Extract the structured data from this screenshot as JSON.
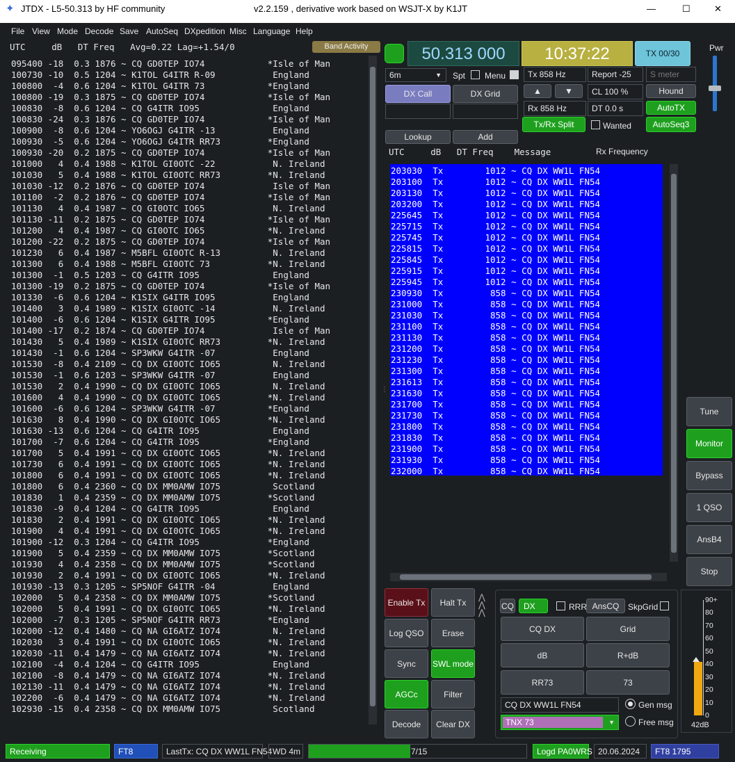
{
  "window": {
    "title": "JTDX - L5-50.313  by HF community",
    "version": "v2.2.159 , derivative work based on WSJT-X by K1JT",
    "minimize": "—",
    "maximize": "☐",
    "close": "✕"
  },
  "menu": [
    "File",
    "View",
    "Mode",
    "Decode",
    "Save",
    "AutoSeq",
    "DXpedition",
    "Misc",
    "Language",
    "Help"
  ],
  "band_header": "UTC     dB   DT Freq   Avg=0.22 Lag=+1.54/0",
  "band_activity_label": "Band Activity",
  "band_rows": [
    "095400 -18  0.3 1876 ~ CQ GD0TEP IO74            *Isle of Man",
    "100730 -10  0.5 1204 ~ K1TOL G4ITR R-09           England",
    "100800  -4  0.6 1204 ~ K1TOL G4ITR 73            *England",
    "100800 -19  0.3 1875 ~ CQ GD0TEP IO74            *Isle of Man",
    "100830  -8  0.6 1204 ~ CQ G4ITR IO95              England",
    "100830 -24  0.3 1876 ~ CQ GD0TEP IO74            *Isle of Man",
    "100900  -8  0.6 1204 ~ YO6OGJ G4ITR -13           England",
    "100930  -5  0.6 1204 ~ YO6OGJ G4ITR RR73         *England",
    "100930 -20  0.2 1875 ~ CQ GD0TEP IO74            *Isle of Man",
    "101000   4  0.4 1988 ~ K1TOL GI0OTC -22           N. Ireland",
    "101030   5  0.4 1988 ~ K1TOL GI0OTC RR73         *N. Ireland",
    "101030 -12  0.2 1876 ~ CQ GD0TEP IO74             Isle of Man",
    "101100  -2  0.2 1876 ~ CQ GD0TEP IO74            *Isle of Man",
    "101130   4  0.4 1987 ~ CQ GI0OTC IO65             N. Ireland",
    "101130 -11  0.2 1875 ~ CQ GD0TEP IO74            *Isle of Man",
    "101200   4  0.4 1987 ~ CQ GI0OTC IO65            *N. Ireland",
    "101200 -22  0.2 1875 ~ CQ GD0TEP IO74            *Isle of Man",
    "101230   6  0.4 1987 ~ M5BFL GI0OTC R-13          N. Ireland",
    "101300   6  0.4 1988 ~ M5BFL GI0OTC 73           *N. Ireland",
    "101300  -1  0.5 1203 ~ CQ G4ITR IO95              England",
    "101300 -19  0.2 1875 ~ CQ GD0TEP IO74            *Isle of Man",
    "101330  -6  0.6 1204 ~ K1SIX G4ITR IO95           England",
    "101400   3  0.4 1989 ~ K1SIX GI0OTC -14           N. Ireland",
    "101400  -6  0.6 1204 ~ K1SIX G4ITR IO95          *England",
    "101400 -17  0.2 1874 ~ CQ GD0TEP IO74             Isle of Man",
    "101430   5  0.4 1989 ~ K1SIX GI0OTC RR73         *N. Ireland",
    "101430  -1  0.6 1204 ~ SP3WKW G4ITR -07           England",
    "101530  -8  0.4 2109 ~ CQ DX GI0OTC IO65          N. Ireland",
    "101530  -1  0.6 1203 ~ SP3WKW G4ITR -07           England",
    "101530   2  0.4 1990 ~ CQ DX GI0OTC IO65          N. Ireland",
    "101600   4  0.4 1990 ~ CQ DX GI0OTC IO65         *N. Ireland",
    "101600  -6  0.6 1204 ~ SP3WKW G4ITR -07          *England",
    "101630   8  0.4 1990 ~ CQ DX GI0OTC IO65         *N. Ireland",
    "101630 -13  0.6 1204 ~ CQ G4ITR IO95              England",
    "101700  -7  0.6 1204 ~ CQ G4ITR IO95             *England",
    "101700   5  0.4 1991 ~ CQ DX GI0OTC IO65         *N. Ireland",
    "101730   6  0.4 1991 ~ CQ DX GI0OTC IO65         *N. Ireland",
    "101800   6  0.4 1991 ~ CQ DX GI0OTC IO65         *N. Ireland",
    "101800   6  0.4 2360 ~ CQ DX MM0AMW IO75          Scotland",
    "101830   1  0.4 2359 ~ CQ DX MM0AMW IO75         *Scotland",
    "101830  -9  0.4 1204 ~ CQ G4ITR IO95              England",
    "101830   2  0.4 1991 ~ CQ DX GI0OTC IO65         *N. Ireland",
    "101900   4  0.4 1991 ~ CQ DX GI0OTC IO65         *N. Ireland",
    "101900 -12  0.3 1204 ~ CQ G4ITR IO95             *England",
    "101900   5  0.4 2359 ~ CQ DX MM0AMW IO75         *Scotland",
    "101930   4  0.4 2358 ~ CQ DX MM0AMW IO75         *Scotland",
    "101930   2  0.4 1991 ~ CQ DX GI0OTC IO65         *N. Ireland",
    "101930 -13  0.3 1205 ~ SP5NOF G4ITR -04           England",
    "102000   5  0.4 2358 ~ CQ DX MM0AMW IO75         *Scotland",
    "102000   5  0.4 1991 ~ CQ DX GI0OTC IO65         *N. Ireland",
    "102000  -7  0.3 1205 ~ SP5NOF G4ITR RR73         *England",
    "102000 -12  0.4 1480 ~ CQ NA GI6ATZ IO74          N. Ireland",
    "102030   3  0.4 1991 ~ CQ DX GI0OTC IO65         *N. Ireland",
    "102030 -11  0.4 1479 ~ CQ NA GI6ATZ IO74         *N. Ireland",
    "102100  -4  0.4 1204 ~ CQ G4ITR IO95              England",
    "102100  -8  0.4 1479 ~ CQ NA GI6ATZ IO74         *N. Ireland",
    "102130 -11  0.4 1479 ~ CQ NA GI6ATZ IO74         *N. Ireland",
    "102200  -6  0.4 1479 ~ CQ NA GI6ATZ IO74         *N. Ireland",
    "102930 -15  0.4 2358 ~ CQ DX MM0AMW IO75          Scotland"
  ],
  "freq_display": "50.313 000",
  "time_display": "10:37:22",
  "tx_counter": "TX 00/30",
  "pwr_label": "Pwr",
  "band_select": "6m",
  "spt_label": "Spt",
  "menu_label": "Menu",
  "tx_freq": "Tx  858  Hz",
  "report": "Report -25",
  "smeter_placeholder": "S meter",
  "dx_call_btn": "DX Call",
  "dx_grid_btn": "DX Grid",
  "up_arrow": "▲",
  "down_arrow": "▼",
  "cl": "CL  100 %",
  "hound_btn": "Hound",
  "rx_freq": "Rx  858  Hz",
  "dt": "DT 0.0 s",
  "autotx_btn": "AutoTX",
  "txrx_split_btn": "Tx/Rx Split",
  "wanted_label": "Wanted",
  "autoseq3_btn": "AutoSeq3",
  "lookup_btn": "Lookup",
  "add_btn": "Add",
  "rx_header": "UTC     dB   DT Freq    Message",
  "rx_freq_label": "Rx Frequency",
  "rx_rows": [
    "203030  Tx        1012 ~ CQ DX WW1L FN54",
    "203100  Tx        1012 ~ CQ DX WW1L FN54",
    "203130  Tx        1012 ~ CQ DX WW1L FN54",
    "203200  Tx        1012 ~ CQ DX WW1L FN54",
    "225645  Tx        1012 ~ CQ DX WW1L FN54",
    "225715  Tx        1012 ~ CQ DX WW1L FN54",
    "225745  Tx        1012 ~ CQ DX WW1L FN54",
    "225815  Tx        1012 ~ CQ DX WW1L FN54",
    "225845  Tx        1012 ~ CQ DX WW1L FN54",
    "225915  Tx        1012 ~ CQ DX WW1L FN54",
    "225945  Tx        1012 ~ CQ DX WW1L FN54",
    "230930  Tx         858 ~ CQ DX WW1L FN54",
    "231000  Tx         858 ~ CQ DX WW1L FN54",
    "231030  Tx         858 ~ CQ DX WW1L FN54",
    "231100  Tx         858 ~ CQ DX WW1L FN54",
    "231130  Tx         858 ~ CQ DX WW1L FN54",
    "231200  Tx         858 ~ CQ DX WW1L FN54",
    "231230  Tx         858 ~ CQ DX WW1L FN54",
    "231300  Tx         858 ~ CQ DX WW1L FN54",
    "231613  Tx         858 ~ CQ DX WW1L FN54",
    "231630  Tx         858 ~ CQ DX WW1L FN54",
    "231700  Tx         858 ~ CQ DX WW1L FN54",
    "231730  Tx         858 ~ CQ DX WW1L FN54",
    "231800  Tx         858 ~ CQ DX WW1L FN54",
    "231830  Tx         858 ~ CQ DX WW1L FN54",
    "231900  Tx         858 ~ CQ DX WW1L FN54",
    "231930  Tx         858 ~ CQ DX WW1L FN54",
    "232000  Tx         858 ~ CQ DX WW1L FN54"
  ],
  "side_buttons": [
    "Tune",
    "Monitor",
    "Bypass",
    "1 QSO",
    "AnsB4",
    "Stop"
  ],
  "ctrl": {
    "enable_tx": "Enable Tx",
    "halt_tx": "Halt Tx",
    "log_qso": "Log QSO",
    "erase": "Erase",
    "sync": "Sync",
    "swl_mode": "SWL mode",
    "agcc": "AGCc",
    "filter": "Filter",
    "decode": "Decode",
    "clear_dx": "Clear DX"
  },
  "txpanel": {
    "cq": "CQ",
    "dx": "DX",
    "rrr": "RRR",
    "anscq": "AnsCQ",
    "skpgrid": "SkpGrid",
    "cq_dx": "CQ DX",
    "grid": "Grid",
    "db": "dB",
    "r_db": "R+dB",
    "rr73": "RR73",
    "s73": "73",
    "gen_msg_text": "CQ DX WW1L FN54",
    "gen_msg": "Gen msg",
    "free_msg_text": "TNX 73",
    "free_msg": "Free msg"
  },
  "meter": {
    "ticks": [
      "90+",
      "80",
      "70",
      "60",
      "50",
      "40",
      "30",
      "20",
      "10",
      "0"
    ],
    "level_db": 42,
    "readout": "42dB"
  },
  "status": {
    "receiving": "Receiving",
    "mode": "FT8",
    "last_tx": "LastTx: CQ DX WW1L FN54",
    "wd": "WD 4m",
    "progress_text": "7/15",
    "progress_fraction": 0.4667,
    "logd": "Logd PA0WRS",
    "date": "20.06.2024",
    "mode_freq": "FT8  1795"
  }
}
